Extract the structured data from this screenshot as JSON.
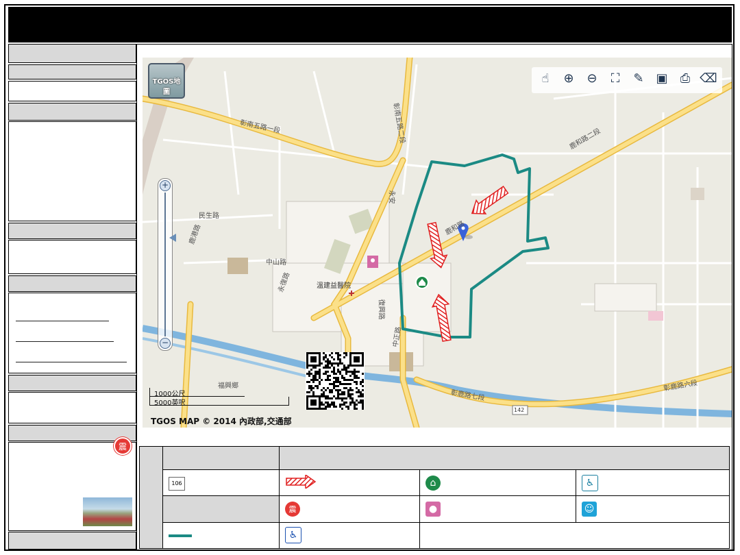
{
  "map": {
    "badge_label": "TGOS地圖",
    "copyright": "TGOS MAP © 2014 內政部,交通部",
    "scale_metric": "1000公尺",
    "scale_imperial": "5000英呎",
    "route_marker": "142",
    "toolbar": [
      {
        "name": "pan-hand-icon",
        "glyph": "☝"
      },
      {
        "name": "zoom-in-icon",
        "glyph": "⊕"
      },
      {
        "name": "zoom-out-icon",
        "glyph": "⊖"
      },
      {
        "name": "full-extent-icon",
        "glyph": "⛶"
      },
      {
        "name": "draw-pen-icon",
        "glyph": "✎"
      },
      {
        "name": "comment-icon",
        "glyph": "▣"
      },
      {
        "name": "print-icon",
        "glyph": "⎙"
      },
      {
        "name": "eraser-icon",
        "glyph": "⌫"
      }
    ],
    "road_labels": [
      {
        "text": "彰南五路一段"
      },
      {
        "text": "彰南五路二段"
      },
      {
        "text": "彰鹿路七段"
      },
      {
        "text": "彰鹿路六段"
      },
      {
        "text": "鹿和路"
      },
      {
        "text": "鹿和路二段"
      },
      {
        "text": "中山路"
      },
      {
        "text": "永安"
      },
      {
        "text": "鹿港路"
      },
      {
        "text": "中正路"
      },
      {
        "text": "永復路"
      },
      {
        "text": "民生路"
      },
      {
        "text": "復興路"
      },
      {
        "text": "福興鄉"
      }
    ],
    "poi_labels": [
      {
        "text": "溫建益醫院"
      }
    ],
    "zoom_in": "+",
    "zoom_out": "−"
  },
  "sidebar": {
    "quake_icon": "震"
  },
  "legend": {
    "route_number": "106",
    "quake_icon": "震"
  },
  "colors": {
    "boundary": "#1b8a84",
    "arrow": "#e02020",
    "road_major": "#f7d25a",
    "river": "#7fb5de",
    "marker": "#3a62d8"
  }
}
